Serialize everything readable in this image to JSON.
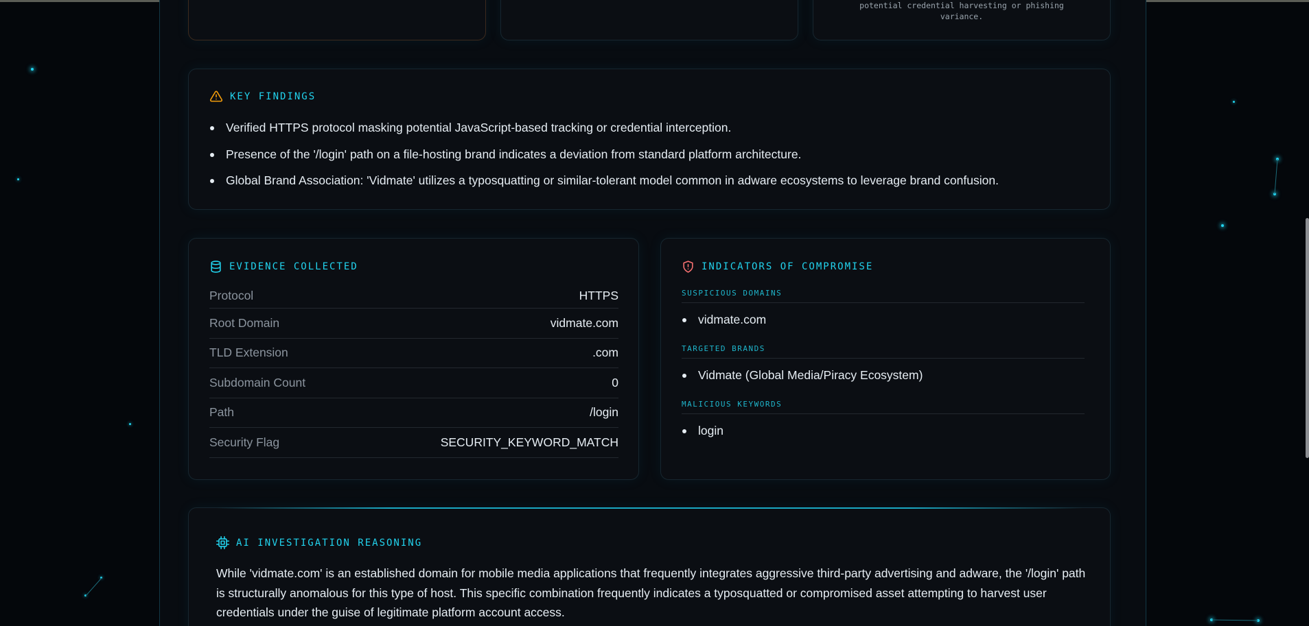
{
  "theme": {
    "accent": "#22d3ee",
    "warning": "#f59e0b",
    "danger": "#f87171",
    "background": "#04070b",
    "card_background": "#0b0e13"
  },
  "top_cards": {
    "right_note": "potential credential harvesting or phishing variance."
  },
  "key_findings": {
    "title": "KEY FINDINGS",
    "icon": "warning-triangle-icon",
    "items": [
      "Verified HTTPS protocol masking potential JavaScript-based tracking or credential interception.",
      "Presence of the '/login' path on a file-hosting brand indicates a deviation from standard platform architecture.",
      "Global Brand Association: 'Vidmate' utilizes a typosquatting or similar-tolerant model common in adware ecosystems to leverage brand confusion."
    ]
  },
  "evidence": {
    "title": "EVIDENCE COLLECTED",
    "icon": "database-icon",
    "rows": [
      {
        "label": "Protocol",
        "value": "HTTPS"
      },
      {
        "label": "Root Domain",
        "value": "vidmate.com"
      },
      {
        "label": "TLD Extension",
        "value": ".com"
      },
      {
        "label": "Subdomain Count",
        "value": "0"
      },
      {
        "label": "Path",
        "value": "/login"
      },
      {
        "label": "Security Flag",
        "value": "SECURITY_KEYWORD_MATCH"
      }
    ]
  },
  "ioc": {
    "title": "INDICATORS OF COMPROMISE",
    "icon": "shield-alert-icon",
    "groups": [
      {
        "heading": "SUSPICIOUS DOMAINS",
        "items": [
          "vidmate.com"
        ]
      },
      {
        "heading": "TARGETED BRANDS",
        "items": [
          "Vidmate (Global Media/Piracy Ecosystem)"
        ]
      },
      {
        "heading": "MALICIOUS KEYWORDS",
        "items": [
          "login"
        ]
      }
    ]
  },
  "reasoning": {
    "title": "AI INVESTIGATION REASONING",
    "icon": "cpu-chip-icon",
    "text": "While 'vidmate.com' is an established domain for mobile media applications that frequently integrates aggressive third-party advertising and adware, the '/login' path is structurally anomalous for this type of host. This specific combination frequently indicates a typosquatted or compromised asset attempting to harvest user credentials under the guise of legitimate platform account access."
  }
}
